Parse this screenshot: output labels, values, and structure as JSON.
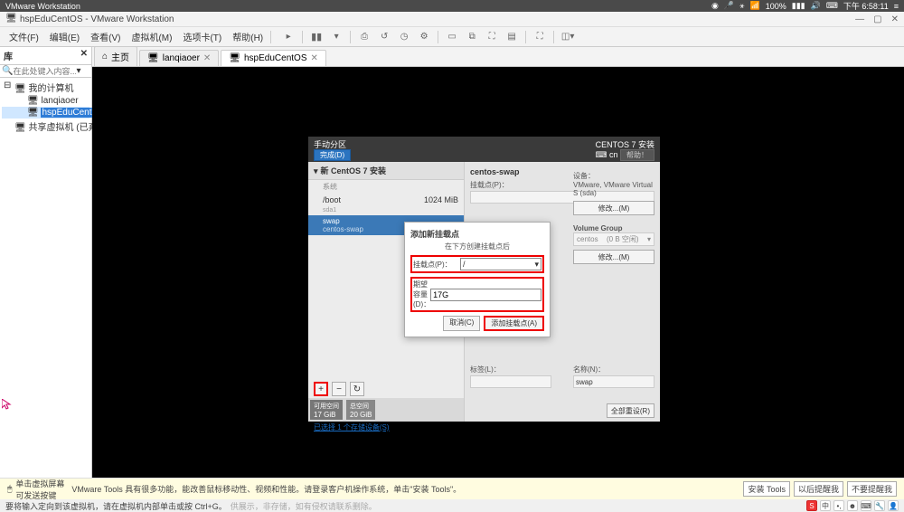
{
  "sysbar": {
    "app": "VMware Workstation",
    "battery": "100%",
    "time": "下午 6:58:11"
  },
  "titlebar": {
    "text": "hspEduCentOS - VMware Workstation"
  },
  "menu": {
    "file": "文件(F)",
    "edit": "编辑(E)",
    "view": "查看(V)",
    "vm": "虚拟机(M)",
    "tabs": "选项卡(T)",
    "help": "帮助(H)"
  },
  "sidebar": {
    "title": "库",
    "search_ph": "在此处键入内容...",
    "root": "我的计算机",
    "vm1": "lanqiaoer",
    "vm2": "hspEduCentOS",
    "shared": "共享虚拟机 (已弃用)"
  },
  "tabs": {
    "home": "主页",
    "t1": "lanqiaoer",
    "t2": "hspEduCentOS"
  },
  "installer": {
    "title_left": "手动分区",
    "done": "完成(D)",
    "title_right": "CENTOS 7 安装",
    "lang": "cn",
    "help": "帮助！",
    "new_install": "新 CentOS 7 安装",
    "system": "系统",
    "boot": "/boot",
    "boot_sub": "sda1",
    "boot_size": "1024 MiB",
    "swap": "swap",
    "swap_sub": "centos-swap",
    "centos_swap": "centos-swap",
    "mount_lbl": "挂载点(P)：",
    "device_lbl": "设备：",
    "device_val": "VMware, VMware Virtual S (sda)",
    "modify": "修改...(M)",
    "vg_lbl": "Volume Group",
    "vg_val": "centos",
    "vg_free": "(0 B 空闲)",
    "label_lbl": "标签(L)：",
    "name_lbl": "名称(N)：",
    "name_val": "swap",
    "avail": "可用空间",
    "avail_v": "17 GiB",
    "total": "总空间",
    "total_v": "20 GiB",
    "sel_link": "已选择 1 个存储设备(S)",
    "reset": "全部重设(R)"
  },
  "modal": {
    "title": "添加新挂载点",
    "desc": "在下方创建挂载点后",
    "mount_lbl": "挂载点(P)：",
    "mount_val": "/",
    "cap_lbl": "期望容量(D)：",
    "cap_val": "17G",
    "cancel": "取消(C)",
    "add": "添加挂载点(A)"
  },
  "hint": {
    "left1": "单击虚拟屏幕",
    "left2": "可发送按键",
    "msg": "VMware Tools 具有很多功能，能改善鼠标移动性、视频和性能。请登录客户机操作系统，单击\"安装 Tools\"。",
    "b1": "安装 Tools",
    "b2": "以后提醒我",
    "b3": "不要提醒我"
  },
  "status": {
    "msg": "要将输入定向到该虚拟机，请在虚拟机内部单击或按 Ctrl+G。",
    "wm": "供展示，非存储，如有侵权请联系删除。"
  }
}
